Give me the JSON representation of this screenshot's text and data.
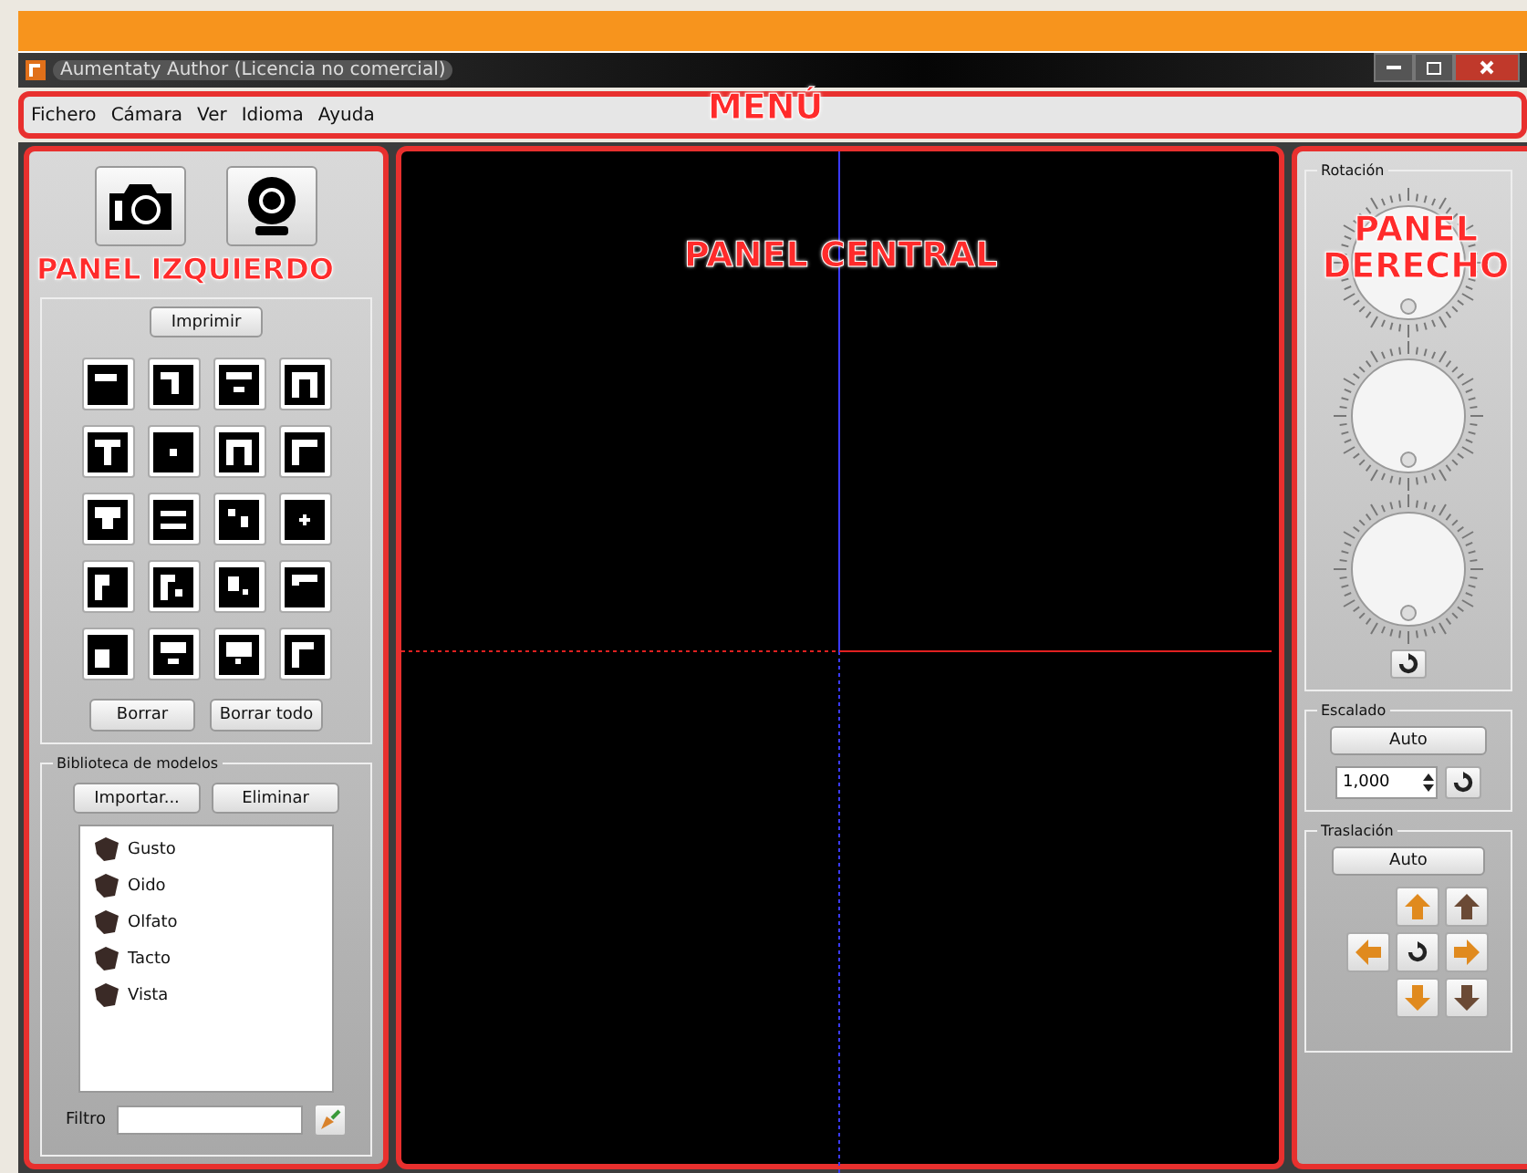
{
  "window": {
    "title": "Aumentaty Author (Licencia no comercial)"
  },
  "menu": [
    "Fichero",
    "Cámara",
    "Ver",
    "Idioma",
    "Ayuda"
  ],
  "annotations": {
    "menu": "MENÚ",
    "left": "PANEL IZQUIERDO",
    "center": "PANEL CENTRAL",
    "right": "PANEL DERECHO"
  },
  "left_panel": {
    "print_button": "Imprimir",
    "clear_buttons": [
      "Borrar",
      "Borrar todo"
    ],
    "library": {
      "title": "Biblioteca de modelos",
      "buttons": [
        "Importar...",
        "Eliminar"
      ],
      "models": [
        "Gusto",
        "Oido",
        "Olfato",
        "Tacto",
        "Vista"
      ],
      "filter_label": "Filtro"
    }
  },
  "right_panel": {
    "rotation": {
      "title": "Rotación"
    },
    "scaling": {
      "title": "Escalado",
      "button": "Auto",
      "value": "1,000"
    },
    "translation": {
      "title": "Traslación",
      "button": "Auto"
    }
  }
}
